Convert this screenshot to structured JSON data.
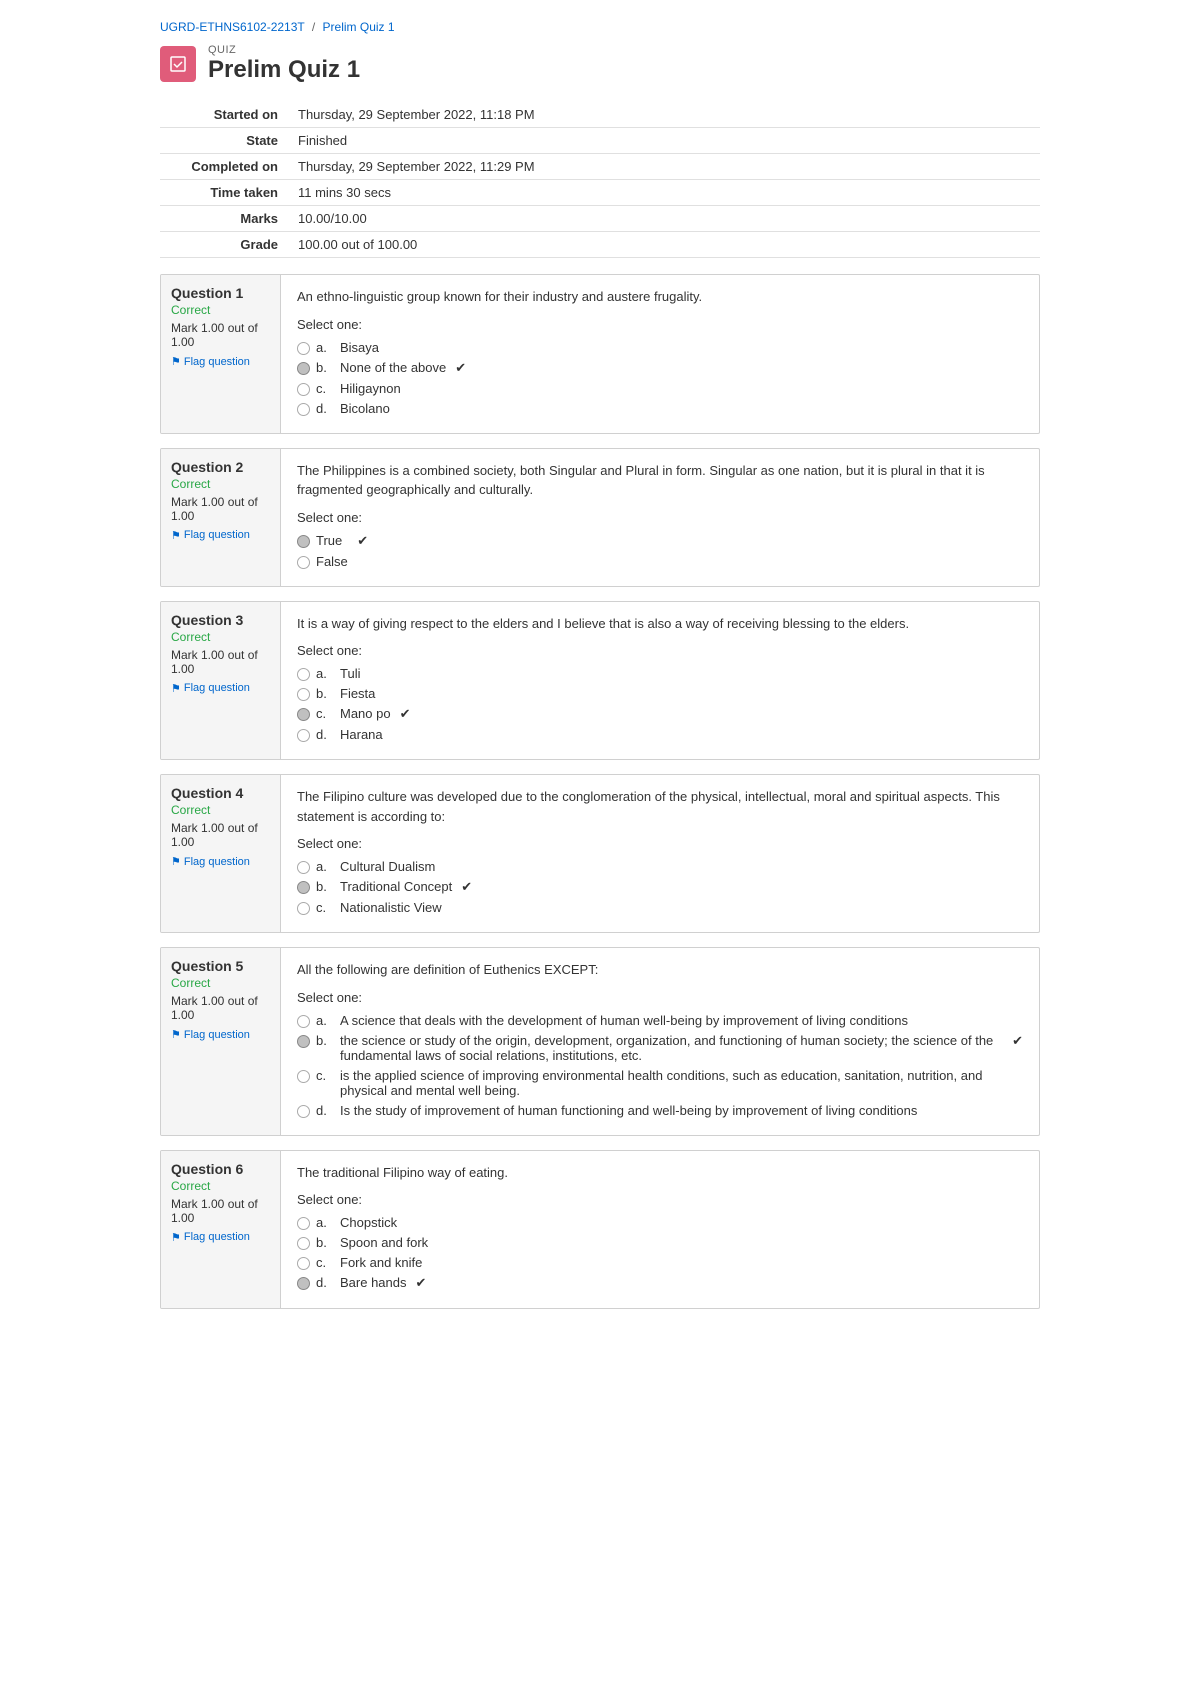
{
  "breadcrumb": {
    "course": "UGRD-ETHNS6102-2213T",
    "sep": "/",
    "page": "Prelim Quiz 1"
  },
  "quiz": {
    "label": "QUIZ",
    "title": "Prelim Quiz 1",
    "icon": "✎"
  },
  "info": {
    "started_on_label": "Started on",
    "started_on_value": "Thursday, 29 September 2022, 11:18 PM",
    "state_label": "State",
    "state_value": "Finished",
    "completed_on_label": "Completed on",
    "completed_on_value": "Thursday, 29 September 2022, 11:29 PM",
    "time_taken_label": "Time taken",
    "time_taken_value": "11 mins 30 secs",
    "marks_label": "Marks",
    "marks_value": "10.00/10.00",
    "grade_label": "Grade",
    "grade_value": "100.00 out of 100.00"
  },
  "questions": [
    {
      "number": "Question 1",
      "status": "Correct",
      "mark": "Mark 1.00 out of 1.00",
      "flag": "Flag question",
      "text": "An ethno-linguistic group known for their industry and austere frugality.",
      "select_one": "Select one:",
      "options": [
        {
          "label": "a.",
          "text": "Bisaya",
          "selected": false,
          "correct": false
        },
        {
          "label": "b.",
          "text": "None of the above",
          "selected": true,
          "correct": true
        },
        {
          "label": "c.",
          "text": "Hiligaynon",
          "selected": false,
          "correct": false
        },
        {
          "label": "d.",
          "text": "Bicolano",
          "selected": false,
          "correct": false
        }
      ]
    },
    {
      "number": "Question 2",
      "status": "Correct",
      "mark": "Mark 1.00 out of 1.00",
      "flag": "Flag question",
      "text": "The Philippines is a combined society, both Singular and Plural in form. Singular as one nation, but it is plural in that it is fragmented geographically and culturally.",
      "select_one": "Select one:",
      "options": [
        {
          "label": "True",
          "text": "",
          "selected": true,
          "correct": true
        },
        {
          "label": "False",
          "text": "",
          "selected": false,
          "correct": false
        }
      ]
    },
    {
      "number": "Question 3",
      "status": "Correct",
      "mark": "Mark 1.00 out of 1.00",
      "flag": "Flag question",
      "text": "It is a way of giving respect to the elders and I believe that is also a way of receiving blessing to the elders.",
      "select_one": "Select one:",
      "options": [
        {
          "label": "a.",
          "text": "Tuli",
          "selected": false,
          "correct": false
        },
        {
          "label": "b.",
          "text": "Fiesta",
          "selected": false,
          "correct": false
        },
        {
          "label": "c.",
          "text": "Mano po",
          "selected": true,
          "correct": true
        },
        {
          "label": "d.",
          "text": "Harana",
          "selected": false,
          "correct": false
        }
      ]
    },
    {
      "number": "Question 4",
      "status": "Correct",
      "mark": "Mark 1.00 out of 1.00",
      "flag": "Flag question",
      "text": "The Filipino culture was developed due to the conglomeration of the physical, intellectual, moral and spiritual aspects. This statement is according to:",
      "select_one": "Select one:",
      "options": [
        {
          "label": "a.",
          "text": "Cultural Dualism",
          "selected": false,
          "correct": false
        },
        {
          "label": "b.",
          "text": "Traditional Concept",
          "selected": true,
          "correct": true
        },
        {
          "label": "c.",
          "text": "Nationalistic View",
          "selected": false,
          "correct": false
        }
      ]
    },
    {
      "number": "Question 5",
      "status": "Correct",
      "mark": "Mark 1.00 out of 1.00",
      "flag": "Flag question",
      "text": "All the following are definition of Euthenics EXCEPT:",
      "select_one": "Select one:",
      "options": [
        {
          "label": "a.",
          "text": "A science that deals with the development of human well-being by improvement of living conditions",
          "selected": false,
          "correct": false
        },
        {
          "label": "b.",
          "text": "the science or study of the origin, development, organization, and functioning of human society; the science of the fundamental laws of social relations, institutions, etc.",
          "selected": true,
          "correct": true
        },
        {
          "label": "c.",
          "text": "is the applied science of improving environmental health conditions, such as education, sanitation, nutrition, and physical and mental well being.",
          "selected": false,
          "correct": false
        },
        {
          "label": "d.",
          "text": "Is the study of improvement of human functioning and well-being by improvement of living conditions",
          "selected": false,
          "correct": false
        }
      ]
    },
    {
      "number": "Question 6",
      "status": "Correct",
      "mark": "Mark 1.00 out of 1.00",
      "flag": "Flag question",
      "text": "The traditional Filipino way of eating.",
      "select_one": "Select one:",
      "options": [
        {
          "label": "a.",
          "text": "Chopstick",
          "selected": false,
          "correct": false
        },
        {
          "label": "b.",
          "text": "Spoon and fork",
          "selected": false,
          "correct": false
        },
        {
          "label": "c.",
          "text": "Fork and knife",
          "selected": false,
          "correct": false
        },
        {
          "label": "d.",
          "text": "Bare hands",
          "selected": true,
          "correct": true
        }
      ]
    }
  ],
  "colors": {
    "correct": "#28a745",
    "link": "#0066cc",
    "accent": "#e05c7a"
  }
}
